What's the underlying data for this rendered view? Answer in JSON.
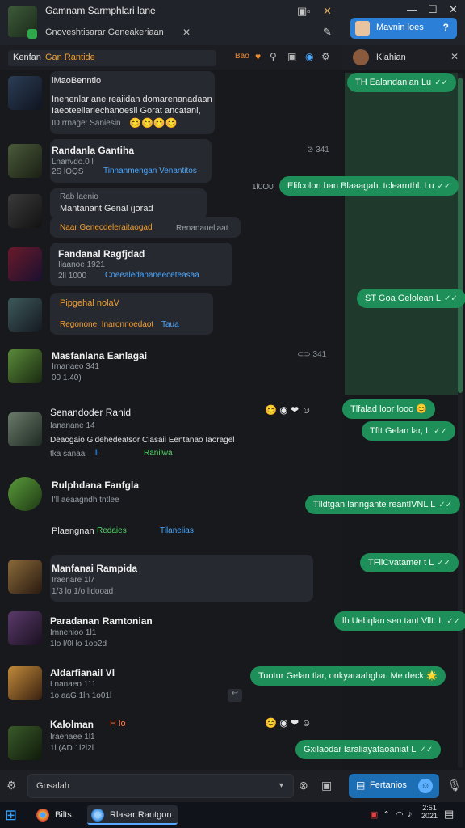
{
  "window": {
    "title": "Gamnam Sarmphlari lane",
    "subtitle": "Gnoveshtisarar Geneakeriaan",
    "controls": {
      "minimize": "—",
      "maximize": "☐",
      "close": "✕"
    }
  },
  "user_pill": {
    "name": "Mavnin loes",
    "help": "?"
  },
  "toolbar": {
    "channel_label": "Kenfan",
    "channel_name": "Gan Rantide",
    "badge": "Bao"
  },
  "right_panel": {
    "header_name": "Klahian"
  },
  "messages": [
    {
      "name": "iMaoBenntio",
      "lines": [
        "Inenenlar ane reaiidan domarenanadaan",
        "Iaeoteeilarlechanoesil Gorat ancatanl,"
      ],
      "meta": "ID rrnage: Saniesin",
      "reactions": "😊😊😊😊"
    },
    {
      "name": "Randanla Gantiha",
      "meta": "Lnanvdo.0 l",
      "meta2": "2S lOQS",
      "link": "Tinnanmengan Venantitos",
      "side": "⊘ 341"
    },
    {
      "name": "Rab laenio",
      "line": "Mantanant Genal (jorad",
      "highlight": "Naar Genecdeleraitaogad",
      "tail": "Renanaueliaat"
    },
    {
      "name": "Fandanal Ragfjdad",
      "meta": "Iiaanoe 1921",
      "meta2": "2ll 1000",
      "link": "Coeealedananeeceteasaa"
    },
    {
      "name": "Pipgehal nolaV",
      "highlight": "Regonone. Inaronnoedaot",
      "link": "Taua"
    },
    {
      "name": "Masfanlana Eanlagai",
      "meta": "Irnanaeo 341",
      "meta2": "00 1.40)",
      "side": "⊂⊃ 341"
    },
    {
      "name": "Senandoder Ranid",
      "meta": "Iananane 14",
      "line": "Deaogaio Gldehedeatsor Clasaii Eentanao Iaoragel",
      "meta2": "tka sanaa",
      "link": "ll",
      "highlight_green": "Ranilwa"
    },
    {
      "name": "Rulphdana Fanfgla",
      "meta": "I'll aeaagndh tntlee",
      "line": "Plaengnan",
      "highlight_green": "Redaies",
      "link": "Tilaneiias"
    },
    {
      "name": "Manfanai Rampida",
      "meta": "Iraenare 1l7",
      "meta2": "1/3 lo 1/o lidooad"
    },
    {
      "name": "Paradanan Ramtonian",
      "meta": "Imnenioo 1l1",
      "meta2": "1lo l/0l lo 1oo2d"
    },
    {
      "name": "Aldarfianail Vl",
      "meta": "Lnanaeo 111",
      "meta2": "1o aaG 1ln 1o01l"
    },
    {
      "name": "Kalolman",
      "tags": "H lo",
      "meta": "Iraenaee 1l1",
      "meta2": "1l (AD 1l2l2l"
    }
  ],
  "outgoing": [
    {
      "text": "TH Ealandanlan Lu"
    },
    {
      "text": "Elifcolon ban Blaaagah. tclearnthl. Lu",
      "time": "1l0O0"
    },
    {
      "text": "ST Goa Gelolean L"
    },
    {
      "text": "Tlfalad loor looo 😊"
    },
    {
      "text": "TfIt Gelan lar, L"
    },
    {
      "text": "Tlldtgan lanngante reantlVNL L"
    },
    {
      "text": "TFilCvatamer t L"
    },
    {
      "text": "lb Uebqlan seo tant Vllt. L"
    },
    {
      "text": "Tuotur Gelan tlar, onkyaraahgha. Me deck 🌟"
    },
    {
      "text": "Gxilaodar laraliayafaoaniat L"
    }
  ],
  "checkmark": "✓✓",
  "composer": {
    "placeholder": "Gnsalah",
    "send_label": "Fertanios"
  },
  "taskbar": {
    "apps": [
      {
        "label": "Bilts"
      },
      {
        "label": "Rlasar Rantgon"
      }
    ],
    "clock_line1": "2:51",
    "clock_line2": "2021"
  }
}
